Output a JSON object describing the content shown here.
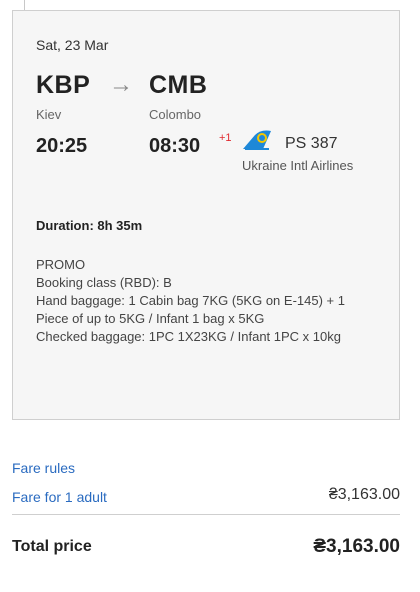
{
  "flight": {
    "date": "Sat, 23 Mar",
    "from_code": "KBP",
    "to_code": "CMB",
    "arrow": "→",
    "from_city": "Kiev",
    "to_city": "Colombo",
    "depart_time": "20:25",
    "arrive_time": "08:30",
    "day_offset": "+1",
    "flight_number": "PS 387",
    "airline": "Ukraine Intl Airlines",
    "airline_logo_icon": "ukraine-intl-airlines-logo-icon",
    "duration": "Duration: 8h 35m"
  },
  "fare_details": {
    "fare_type": "PROMO",
    "booking_class": "Booking class (RBD):  B",
    "hand_baggage": "Hand baggage: 1 Cabin bag 7KG (5KG on E-145) + 1 Piece of up to 5KG / Infant 1 bag x 5KG",
    "checked_baggage": "Checked baggage: 1PC 1X23KG / Infant 1PC x 10kg"
  },
  "pricing": {
    "fare_rules_link": "Fare rules",
    "fare_for_adult_link": "Fare for 1 adult",
    "fare_for_adult_price": "₴3,163.00",
    "total_label": "Total price",
    "total_price": "₴3,163.00"
  },
  "colors": {
    "link": "#2a6bc0",
    "plus_day": "#e0292e",
    "card_background": "#f6f6f6",
    "logo_blue": "#1e88d8",
    "logo_yellow": "#f5c800"
  }
}
